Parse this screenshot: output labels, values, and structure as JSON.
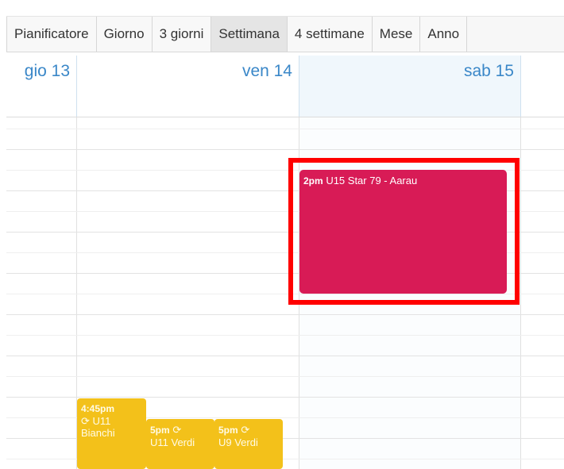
{
  "toolbar": {
    "tabs": [
      {
        "label": "Pianificatore",
        "active": false
      },
      {
        "label": "Giorno",
        "active": false
      },
      {
        "label": "3 giorni",
        "active": false
      },
      {
        "label": "Settimana",
        "active": true
      },
      {
        "label": "4 settimane",
        "active": false
      },
      {
        "label": "Mese",
        "active": false
      },
      {
        "label": "Anno",
        "active": false
      }
    ]
  },
  "days": [
    {
      "label": "gio 13"
    },
    {
      "label": "ven 14"
    },
    {
      "label": "sab 15",
      "today": true
    }
  ],
  "events": {
    "pink": {
      "time": "2pm",
      "title": "U15 Star 79 - Aarau",
      "color": "#d81b56"
    },
    "yellow": [
      {
        "time": "4:45pm",
        "recurring_icon": "repeat-icon",
        "title": "U11 Bianchi",
        "color": "#f3c11a"
      },
      {
        "time": "5pm",
        "recurring_icon": "repeat-icon",
        "title": "U11 Verdi",
        "color": "#f3c11a"
      },
      {
        "time": "5pm",
        "recurring_icon": "repeat-icon",
        "title": "U9 Verdi",
        "color": "#f3c11a"
      }
    ]
  },
  "colors": {
    "highlight": "#ff0000",
    "day_header_text": "#3a87c8"
  }
}
